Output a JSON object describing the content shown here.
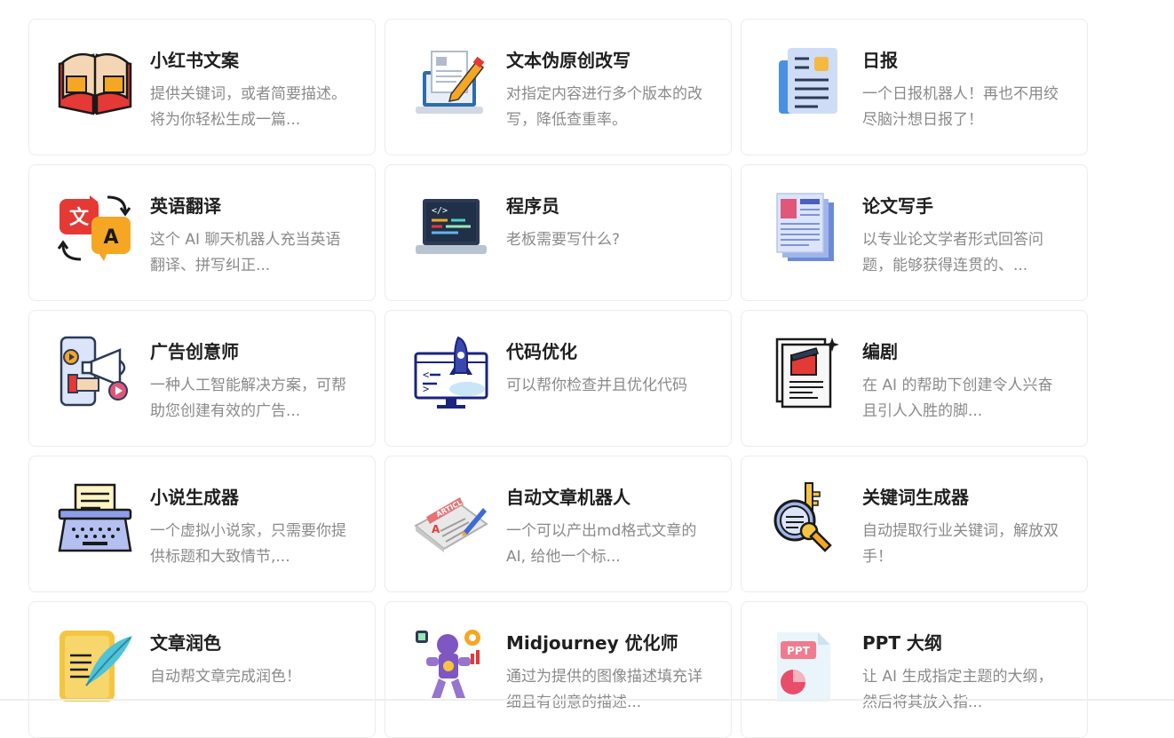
{
  "cards": [
    {
      "title": "小红书文案",
      "desc": "提供关键词，或者简要描述。将为你轻松生成一篇...",
      "icon": "book-icon"
    },
    {
      "title": "文本伪原创改写",
      "desc": "对指定内容进行多个版本的改写，降低查重率。",
      "icon": "laptop-edit-icon"
    },
    {
      "title": "日报",
      "desc": "一个日报机器人！再也不用绞尽脑汁想日报了！",
      "icon": "report-icon"
    },
    {
      "title": "英语翻译",
      "desc": "这个 AI 聊天机器人充当英语翻译、拼写纠正...",
      "icon": "translate-icon"
    },
    {
      "title": "程序员",
      "desc": "老板需要写什么?",
      "icon": "code-laptop-icon"
    },
    {
      "title": "论文写手",
      "desc": "以专业论文学者形式回答问题，能够获得连贯的、...",
      "icon": "paper-icon"
    },
    {
      "title": "广告创意师",
      "desc": "一种人工智能解决方案，可帮助您创建有效的广告...",
      "icon": "megaphone-icon"
    },
    {
      "title": "代码优化",
      "desc": "可以帮你检查并且优化代码",
      "icon": "rocket-monitor-icon"
    },
    {
      "title": "编剧",
      "desc": "在 AI 的帮助下创建令人兴奋且引人入胜的脚...",
      "icon": "script-icon"
    },
    {
      "title": "小说生成器",
      "desc": "一个虚拟小说家，只需要你提供标题和大致情节,...",
      "icon": "typewriter-icon"
    },
    {
      "title": "自动文章机器人",
      "desc": "一个可以产出md格式文章的AI, 给他一个标...",
      "icon": "article-icon"
    },
    {
      "title": "关键词生成器",
      "desc": "自动提取行业关键词，解放双手！",
      "icon": "key-search-icon"
    },
    {
      "title": "文章润色",
      "desc": "自动帮文章完成润色！",
      "icon": "quill-scroll-icon"
    },
    {
      "title": "Midjourney 优化师",
      "desc": "通过为提供的图像描述填充详细且有创意的描述...",
      "icon": "robot-icon"
    },
    {
      "title": "PPT 大纲",
      "desc": "让 AI 生成指定主题的大纲，然后将其放入指...",
      "icon": "ppt-icon"
    }
  ]
}
